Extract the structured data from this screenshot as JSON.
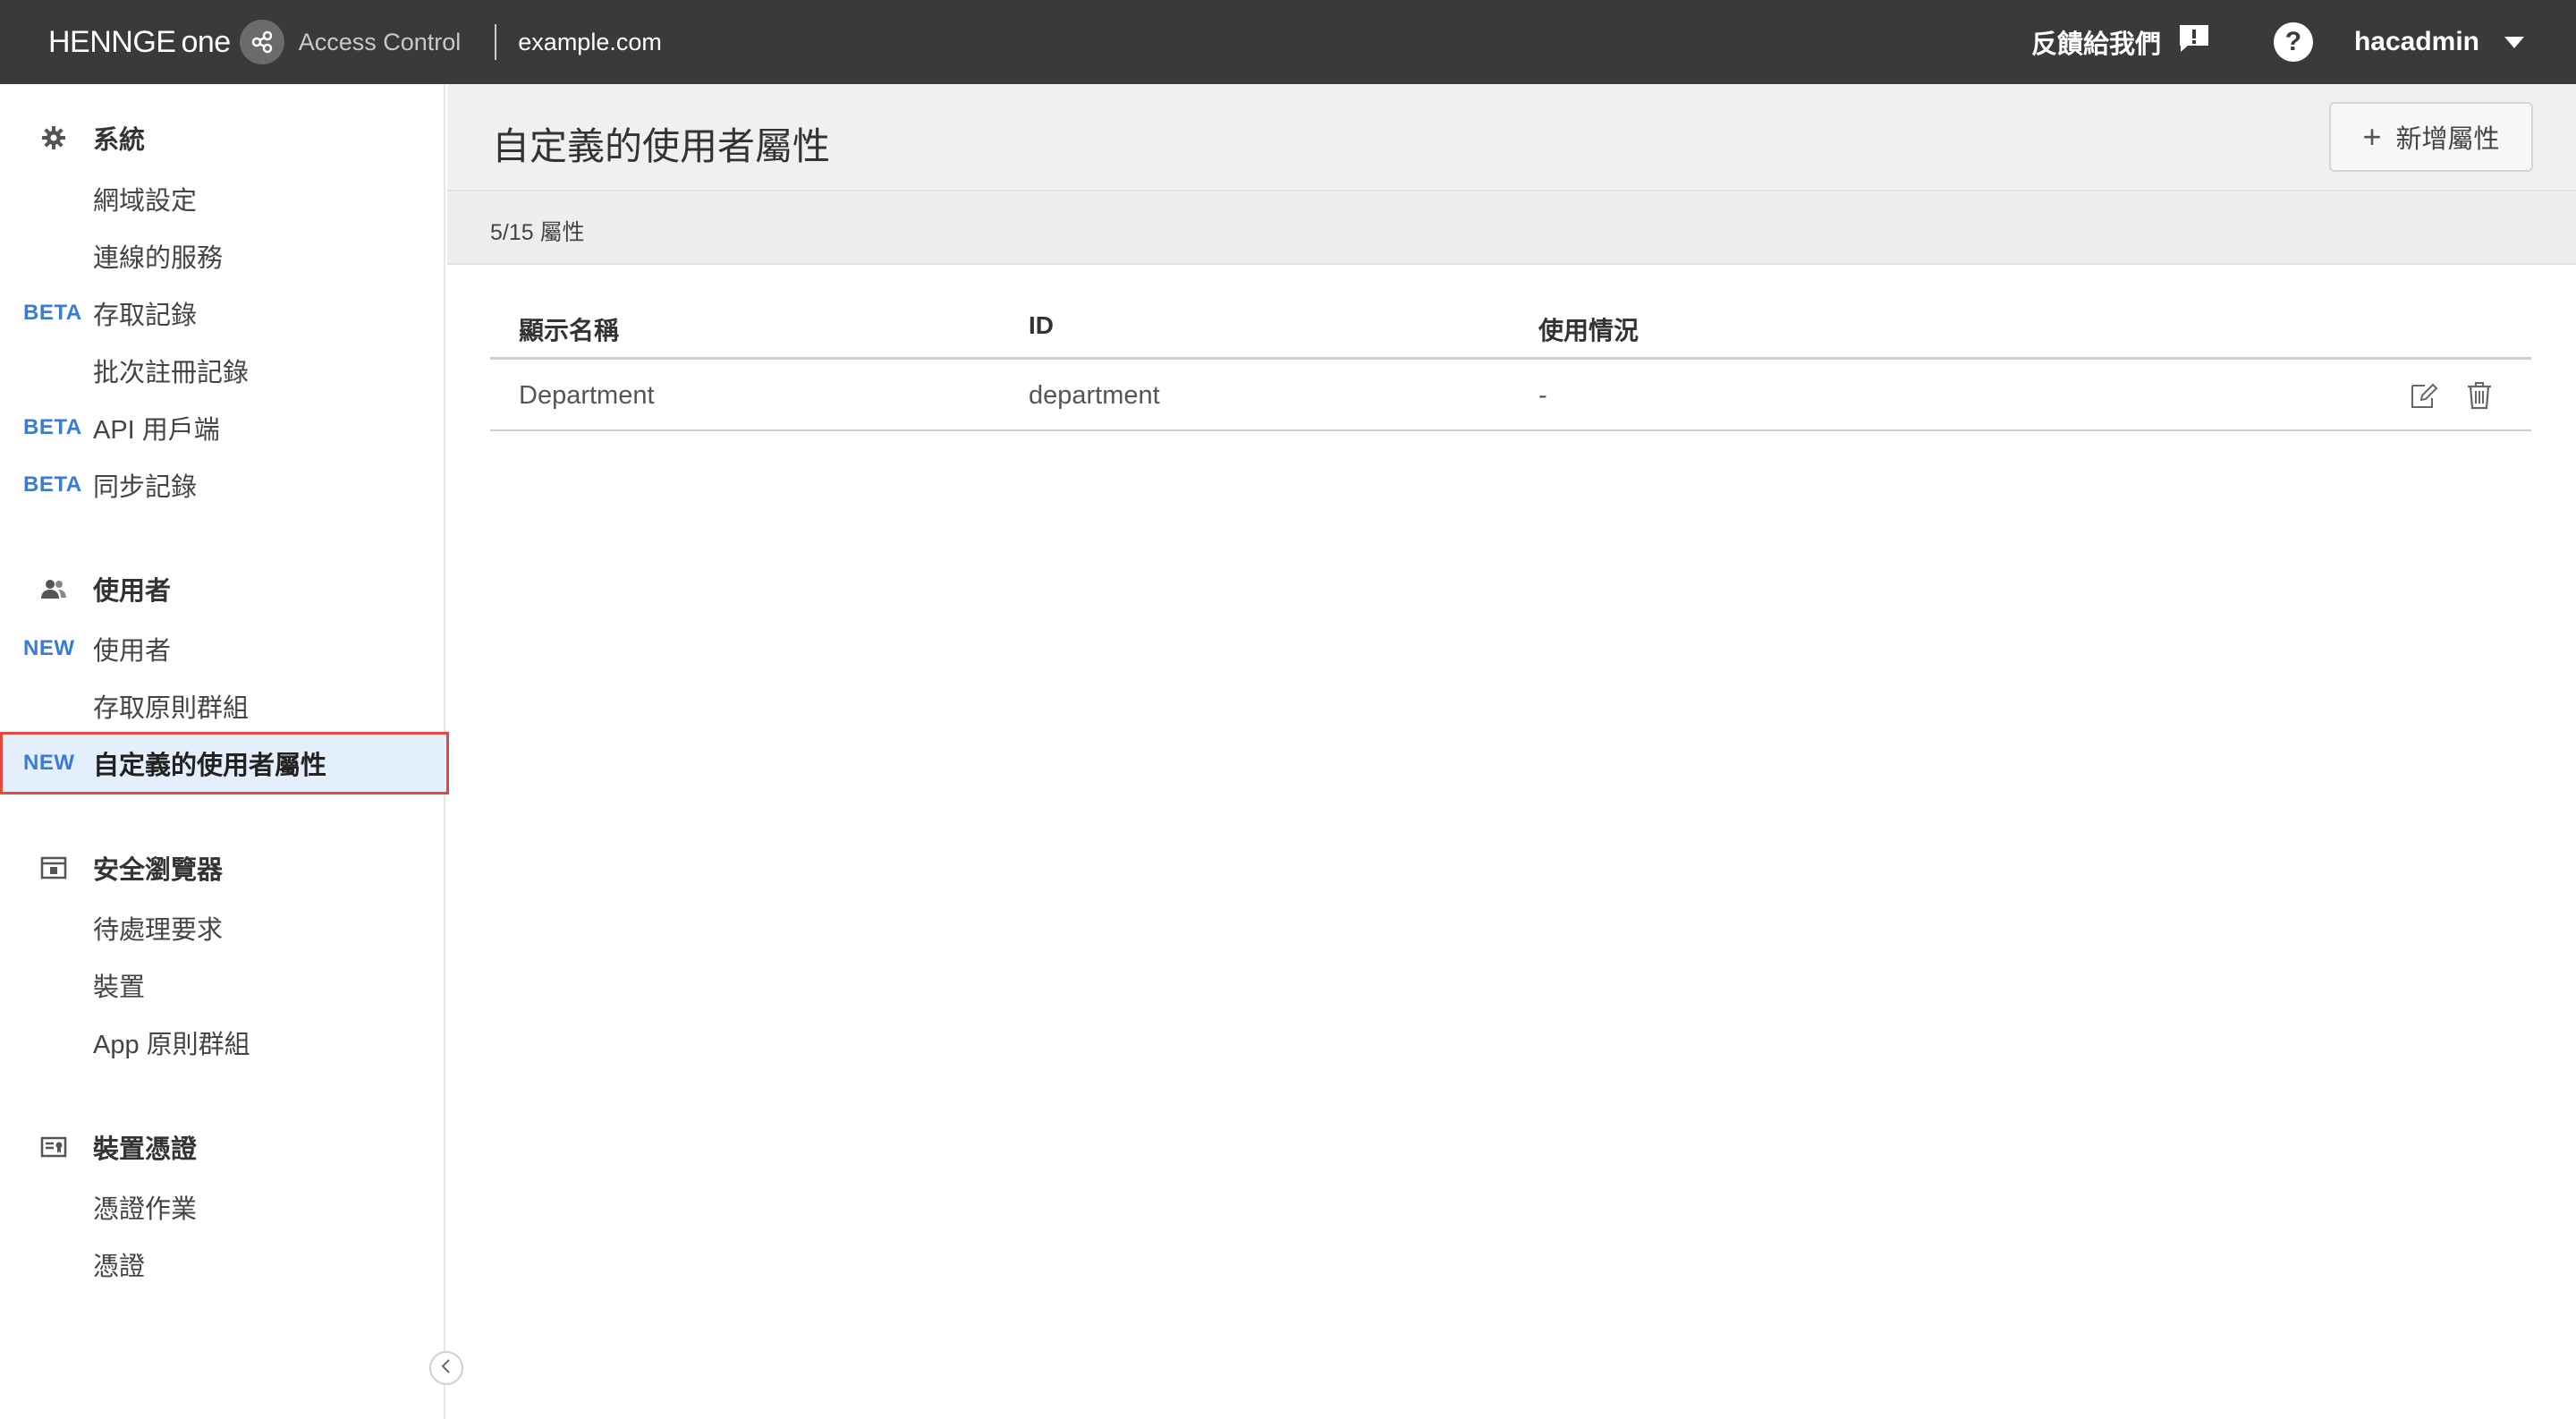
{
  "topbar": {
    "logo_text_left": "HENNGE",
    "logo_text_right": "one",
    "app_name": "Access Control",
    "domain": "example.com",
    "feedback_label": "反饋給我們",
    "help_label": "?",
    "username": "hacadmin"
  },
  "sidebar": {
    "sections": [
      {
        "title": "系統",
        "icon": "gear-icon",
        "items": [
          {
            "tag": "",
            "label": "網域設定"
          },
          {
            "tag": "",
            "label": "連線的服務"
          },
          {
            "tag": "BETA",
            "label": "存取記錄"
          },
          {
            "tag": "",
            "label": "批次註冊記錄"
          },
          {
            "tag": "BETA",
            "label": "API 用戶端"
          },
          {
            "tag": "BETA",
            "label": "同步記錄"
          }
        ]
      },
      {
        "title": "使用者",
        "icon": "users-icon",
        "items": [
          {
            "tag": "NEW",
            "label": "使用者"
          },
          {
            "tag": "",
            "label": "存取原則群組"
          },
          {
            "tag": "NEW",
            "label": "自定義的使用者屬性",
            "active": true
          }
        ]
      },
      {
        "title": "安全瀏覽器",
        "icon": "browser-icon",
        "items": [
          {
            "tag": "",
            "label": "待處理要求"
          },
          {
            "tag": "",
            "label": "裝置"
          },
          {
            "tag": "",
            "label": "App 原則群組"
          }
        ]
      },
      {
        "title": "裝置憑證",
        "icon": "certificate-icon",
        "items": [
          {
            "tag": "",
            "label": "憑證作業"
          },
          {
            "tag": "",
            "label": "憑證"
          }
        ]
      }
    ]
  },
  "main": {
    "title": "自定義的使用者屬性",
    "add_button_label": "新增屬性",
    "count_text": "5/15 屬性",
    "table": {
      "headers": [
        "顯示名稱",
        "ID",
        "使用情況"
      ],
      "rows": [
        [
          "Department",
          "department",
          "-"
        ]
      ]
    }
  },
  "colors": {
    "topbar_bg": "#3a3a3a",
    "tag_blue": "#3a7bd5",
    "active_bg": "#e3effb",
    "active_border": "#e34a3d"
  }
}
